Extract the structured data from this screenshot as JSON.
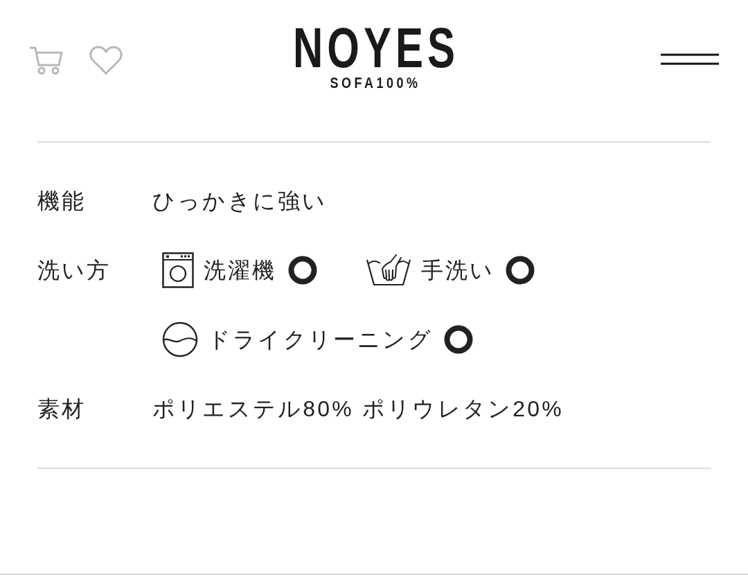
{
  "header": {
    "logo": "NOYES",
    "tagline": "SOFA100%"
  },
  "specs": [
    {
      "kind": "text",
      "label": "機能",
      "value": "ひっかきに強い"
    },
    {
      "kind": "care",
      "label": "洗い方",
      "methods": [
        {
          "kind": "washer",
          "name": "洗濯機",
          "ok": true
        },
        {
          "kind": "hand",
          "name": "手洗い",
          "ok": true
        },
        {
          "kind": "dry",
          "name": "ドライクリーニング",
          "ok": true
        }
      ]
    },
    {
      "kind": "text",
      "label": "素材",
      "value": "ポリエステル80% ポリウレタン20%"
    }
  ]
}
